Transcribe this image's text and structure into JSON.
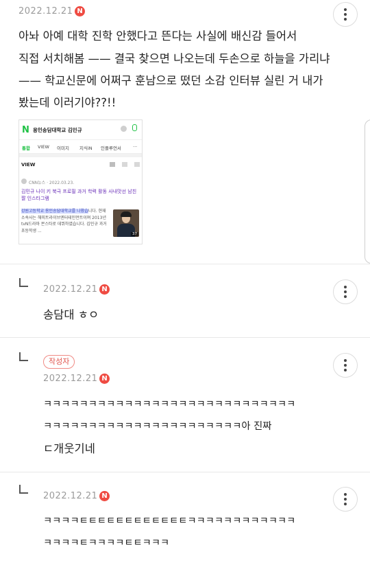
{
  "post": {
    "date": "2022.12.21",
    "badge": "N",
    "lines": [
      "아놔 아예 대학 진학 안했다고 뜬다는 사실에 배신감 들어서",
      "직접 서치해봄 —— 결국 찾으면 나오는데 두손으로 하늘을 가리냐",
      "—— 학교신문에 어쩌구 훈남으로 떴던 소감 인터뷰 실린 거 내가",
      "봤는데 이러기야??!!"
    ],
    "image": {
      "logo": "N",
      "query": "용인송담대학교 김민규",
      "tabs": [
        "통합",
        "VIEW",
        "이미지",
        "지식iN",
        "인플루언서",
        "···"
      ],
      "section": "VIEW",
      "source": "CNN뉴스 · 2022.03.23.",
      "title": "김민규 나이 키 북극 프로필 과거 학력 활동 사내맛선 남친짤 인스타그램",
      "highlight": "강원고등학교 용인송담대학교를 나왔습",
      "body": "니다. 현재 소속사는 해피트라이브엔터테인먼트이며 2013년 tvN드라마 몬스타로 데뷔하였습니다. 김민규 과거 초등학생 ...",
      "thumb_count": "37"
    }
  },
  "comments": [
    {
      "date": "2022.12.21",
      "badge": "N",
      "author_tag": "",
      "lines": [
        "송담대 ㅎㅇ"
      ]
    },
    {
      "date": "2022.12.21",
      "badge": "N",
      "author_tag": "작성자",
      "lines": [
        "ㅋㅋㅋㅋㅋㅋㅋㅋㅋㅋㅋㅋㅋㅋㅋㅋㅋㅋㅋㅋㅋㅋㅋㅋㅋㅋㅋㅋ",
        "ㅋㅋㅋㅋㅋㅋㅋㅋㅋㅋㅋㅋㅋㅋㅋㅋㅋㅋㅋㅋㅋㅋ아 진짜",
        "ㄷ개웃기네"
      ]
    },
    {
      "date": "2022.12.21",
      "badge": "N",
      "author_tag": "",
      "lines": [
        "ㅋㅋㅋㅋㅌㅌㅌㅌㅌㅌㅌㅌㅌㅌㅌㅌㅋㅋㅋㅋㅋㅋㅋㅋㅋㅋㅋㅋ",
        "ㅋㅋㅋㅋㅌㅋㅋㅋㅋㅌㅌㅋㅋㅋ"
      ]
    }
  ],
  "icons": {
    "more": "more-vertical-icon",
    "reply": "reply-arrow-icon"
  },
  "colors": {
    "badge": "#ef4b42",
    "naver_green": "#1fc145",
    "author_tag": "#e0554d"
  }
}
